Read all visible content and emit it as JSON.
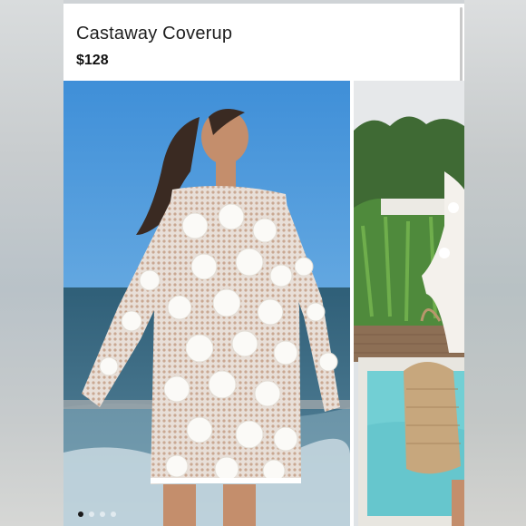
{
  "product": {
    "title": "Castaway Coverup",
    "price": "$128"
  },
  "gallery": {
    "image_count": 4,
    "active_index": 0,
    "images": [
      {
        "alt": "main-product-photo"
      },
      {
        "alt": "secondary-product-photo"
      }
    ]
  },
  "colors": {
    "sky": "#5b9fd6",
    "sea": "#3f6f86",
    "dress": "#f6f3ee",
    "pool": "#7fd3d8",
    "foliage": "#4d7a3a"
  }
}
